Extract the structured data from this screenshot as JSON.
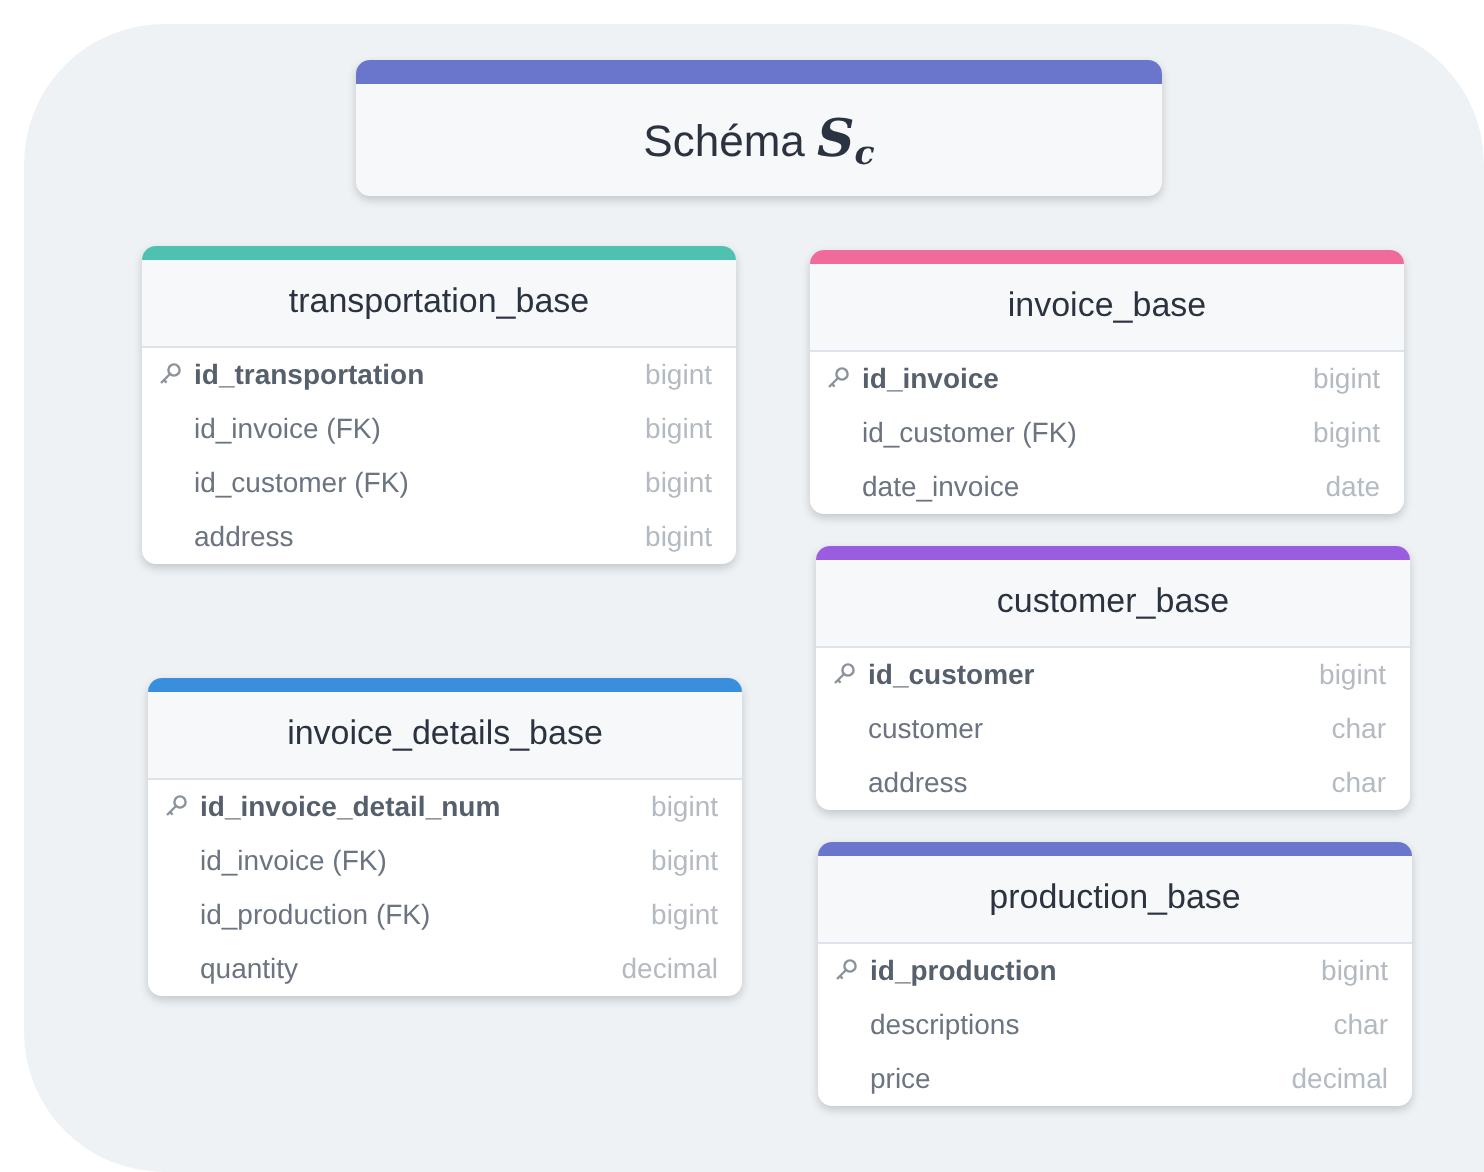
{
  "title": {
    "text": "Schéma **S**$_{c}$",
    "color": "#6a75cc"
  },
  "tables": [
    {
      "name": "transportation_base",
      "color": "#4fc1b0",
      "columns": [
        {
          "name": "id_transportation",
          "type": "bigint",
          "primary_key": true
        },
        {
          "name": "id_invoice (FK)",
          "type": "bigint",
          "primary_key": false
        },
        {
          "name": "id_customer (FK)",
          "type": "bigint",
          "primary_key": false
        },
        {
          "name": "address",
          "type": "bigint",
          "primary_key": false
        }
      ]
    },
    {
      "name": "invoice_base",
      "color": "#f06a9a",
      "columns": [
        {
          "name": "id_invoice",
          "type": "bigint",
          "primary_key": true
        },
        {
          "name": "id_customer (FK)",
          "type": "bigint",
          "primary_key": false
        },
        {
          "name": "date_invoice",
          "type": "date",
          "primary_key": false
        }
      ]
    },
    {
      "name": "customer_base",
      "color": "#9b5de0",
      "columns": [
        {
          "name": "id_customer",
          "type": "bigint",
          "primary_key": true
        },
        {
          "name": "customer",
          "type": "char",
          "primary_key": false
        },
        {
          "name": "address",
          "type": "char",
          "primary_key": false
        }
      ]
    },
    {
      "name": "invoice_details_base",
      "color": "#3a8fdc",
      "columns": [
        {
          "name": "id_invoice_detail_num",
          "type": "bigint",
          "primary_key": true
        },
        {
          "name": "id_invoice (FK)",
          "type": "bigint",
          "primary_key": false
        },
        {
          "name": "id_production (FK)",
          "type": "bigint",
          "primary_key": false
        },
        {
          "name": "quantity",
          "type": "decimal",
          "primary_key": false
        }
      ]
    },
    {
      "name": "production_base",
      "color": "#6a75cc",
      "columns": [
        {
          "name": "id_production",
          "type": "bigint",
          "primary_key": true
        },
        {
          "name": "descriptions",
          "type": "char",
          "primary_key": false
        },
        {
          "name": "price",
          "type": "decimal",
          "primary_key": false
        }
      ]
    }
  ]
}
